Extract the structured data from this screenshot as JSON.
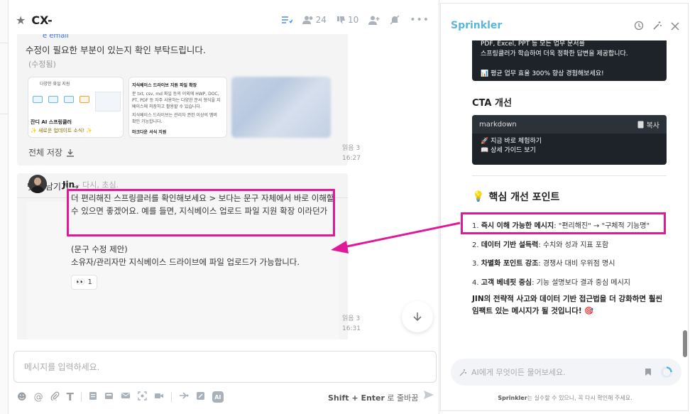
{
  "chat": {
    "title": "CX-",
    "members_count": "24",
    "reactions_count": "10",
    "peek_text": "e email",
    "msg1_text": "수정이 필요한 부분이 있는지 확인 부탁드립니다.",
    "msg1_edited": "(수정됨)",
    "thumb1": {
      "header": "다양한 화일 지원",
      "cap1": "잔디 AI 스프링클러",
      "cap2": "✨ 새로운 업데이트 소식! ✨"
    },
    "thumb2": {
      "title": "지식베이스 드라이브 지원 파일 확장",
      "lines": [
        "문 txt, csv, md 파일 등의 이외에 HWP, DOC,",
        "PT, PDF 등 자주 사용하는 다양한 문서 형식을 지",
        "베이스에 저장하고 활용할 수 있습니다.",
        "지식베이스 드라이브는 관리자 권한 이상의 멤버",
        "확인 가능합니다."
      ],
      "footer": "마크다운 서식 지원"
    },
    "save_all": "전체 저장",
    "read1": "읽음 3",
    "time1": "16:27",
    "comment_link": "댓글 남기기 →",
    "reply_author": "Jin",
    "reply_sub": " - 다시, 초심.",
    "reply_text": "더 편리해진 스프링클러를 확인해보세요 > 보다는 문구 자체에서 바로 이해할 수 있으면 좋겠어요. 예를 들면, 지식베이스 업로드 파일 지원 확장 이라던가",
    "reply_note_line1": "(문구 수정 제안)",
    "reply_note_line2": "소유자/관리자만 지식베이스 드라이브에 파일 업로드가 가능합니다.",
    "reaction_count": "1",
    "read2": "읽음 3",
    "time2": "16:31",
    "input_placeholder": "메시지를 입력하세요.",
    "shift_key": "Shift + Enter",
    "shift_desc": " 로 줄바꿈",
    "ai_label": "AI"
  },
  "panel": {
    "title": "Sprinkler",
    "dark1_lines": [
      "PDF, Excel, PPT 등 모든 업무 문서를",
      "스프링클러가 학습하여 더욱 정확한 답변을 제공합니다.",
      "",
      "📊 평균 업무 효율 300% 향상 경험해보세요!"
    ],
    "cta_heading": "CTA 개선",
    "md_label": "markdown",
    "copy_label": "복사",
    "md_line1": "🚀 지금 바로 체험하기",
    "md_line2": "📖 상세 가이드 보기",
    "core_heading": "핵심 개선 포인트",
    "points": [
      {
        "prefix": "1. ",
        "bold": "즉시 이해 가능한 메시지",
        "rest": ": \"편리해진\" → \"구체적 기능명\""
      },
      {
        "prefix": "2. ",
        "bold": "데이터 기반 설득력",
        "rest": ": 수치와 성과 지표 포함"
      },
      {
        "prefix": "3. ",
        "bold": "차별화 포인트 강조",
        "rest": ": 경쟁사 대비 우위점 명시"
      },
      {
        "prefix": "4. ",
        "bold": "고객 베네핏 중심",
        "rest": ": 기능 설명보다 결과 중심 메시지"
      }
    ],
    "summary": "JIN의 전략적 사고와 데이터 기반 접근법을 더 강화하면 훨씬 임팩트 있는 메시지가 될 것입니다! 🎯",
    "ask_placeholder": "AI에게 무엇이든 물어보세요.",
    "disclaimer_brand": "Sprinkler",
    "disclaimer_rest": "는 실수할 수 있으니, 꼭 다시 확인해 주세요."
  },
  "colors": {
    "highlight": "#e0199a",
    "brand": "#5ab7d8",
    "dark_block": "#1e2329"
  }
}
